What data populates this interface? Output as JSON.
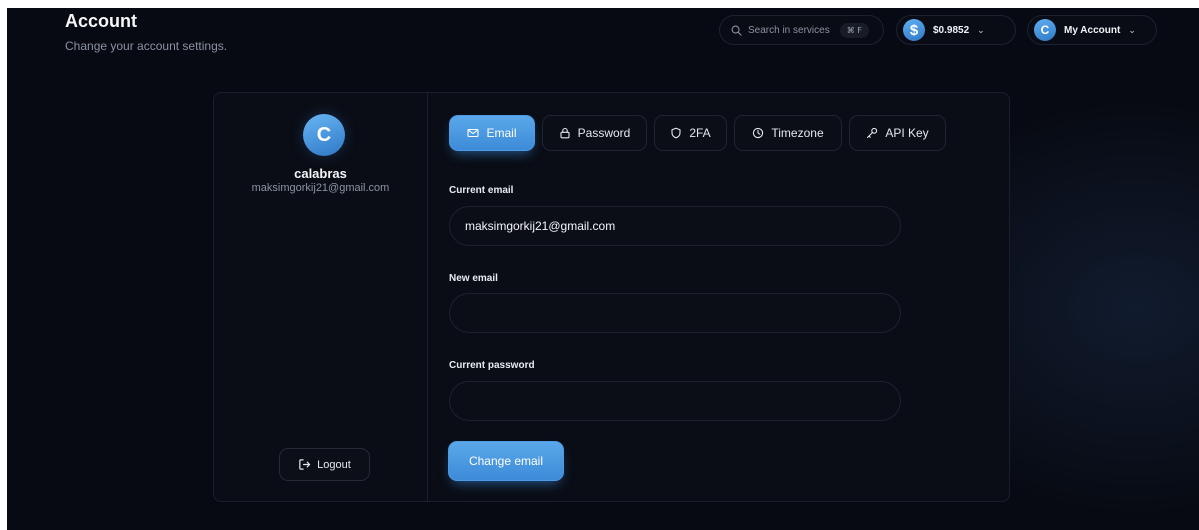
{
  "header": {
    "title": "Account",
    "subtitle": "Change your account settings.",
    "search": {
      "placeholder": "Search in services",
      "shortcut": "⌘ F"
    },
    "balance": {
      "icon": "dollar-icon",
      "value": "$0.9852"
    },
    "account": {
      "avatar_letter": "C",
      "label": "My Account"
    }
  },
  "profile": {
    "avatar_letter": "C",
    "username": "calabras",
    "email": "maksimgorkij21@gmail.com",
    "logout_label": "Logout"
  },
  "tabs": [
    {
      "label": "Email",
      "icon": "mail-icon",
      "active": true
    },
    {
      "label": "Password",
      "icon": "lock-icon",
      "active": false
    },
    {
      "label": "2FA",
      "icon": "shield-icon",
      "active": false
    },
    {
      "label": "Timezone",
      "icon": "clock-icon",
      "active": false
    },
    {
      "label": "API Key",
      "icon": "key-icon",
      "active": false
    }
  ],
  "form": {
    "current_email_label": "Current email",
    "current_email_value": "maksimgorkij21@gmail.com",
    "new_email_label": "New email",
    "new_email_value": "",
    "current_password_label": "Current password",
    "current_password_value": "",
    "submit_label": "Change email"
  },
  "colors": {
    "accent": "#4a97e0",
    "background": "#05070c",
    "card": "#0a0d15"
  }
}
